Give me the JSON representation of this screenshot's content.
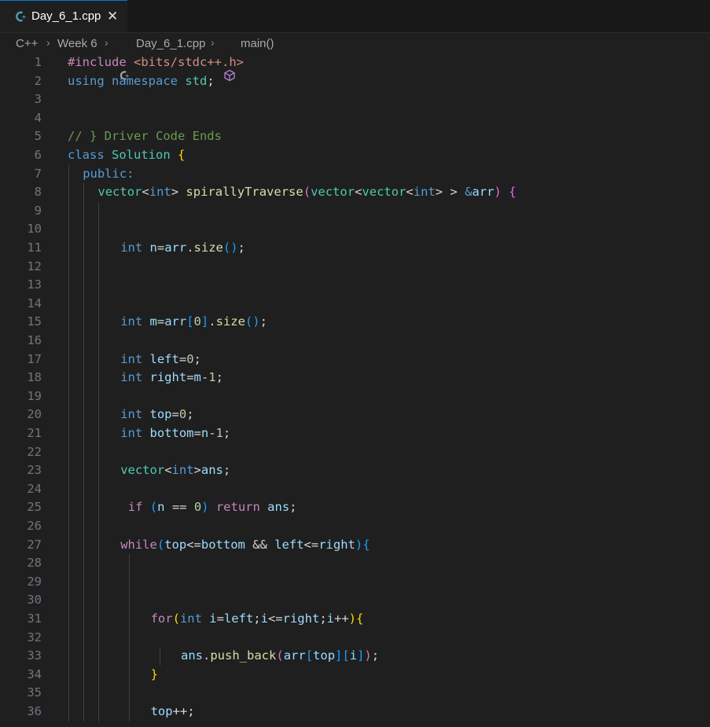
{
  "tab": {
    "icon": "cpp-file-icon",
    "label": "Day_6_1.cpp",
    "close": "✕"
  },
  "breadcrumb": [
    "C++",
    "Week 6",
    "Day_6_1.cpp",
    "main()"
  ],
  "editor": {
    "lines": [
      {
        "n": "1",
        "indent": 0,
        "tokens": [
          [
            "pre",
            "#include "
          ],
          [
            "str",
            "<bits/stdc++.h>"
          ]
        ]
      },
      {
        "n": "2",
        "indent": 0,
        "tokens": [
          [
            "kw",
            "using "
          ],
          [
            "kw",
            "namespace "
          ],
          [
            "type",
            "std"
          ],
          [
            "pl",
            ";"
          ]
        ]
      },
      {
        "n": "3",
        "indent": 0,
        "tokens": []
      },
      {
        "n": "4",
        "indent": 0,
        "tokens": []
      },
      {
        "n": "5",
        "indent": 0,
        "tokens": [
          [
            "cmt",
            "// } Driver Code Ends"
          ]
        ]
      },
      {
        "n": "6",
        "indent": 0,
        "tokens": [
          [
            "kw",
            "class "
          ],
          [
            "type",
            "Solution "
          ],
          [
            "p1",
            "{"
          ]
        ]
      },
      {
        "n": "7",
        "indent": 2,
        "tokens": [
          [
            "kw",
            "public:"
          ]
        ]
      },
      {
        "n": "8",
        "indent": 4,
        "tokens": [
          [
            "type",
            "vector"
          ],
          [
            "op",
            "<"
          ],
          [
            "kw",
            "int"
          ],
          [
            "op",
            "> "
          ],
          [
            "fn",
            "spirallyTraverse"
          ],
          [
            "p2",
            "("
          ],
          [
            "type",
            "vector"
          ],
          [
            "op",
            "<"
          ],
          [
            "type",
            "vector"
          ],
          [
            "op",
            "<"
          ],
          [
            "kw",
            "int"
          ],
          [
            "op",
            "> > "
          ],
          [
            "kw",
            "&"
          ],
          [
            "var",
            "arr"
          ],
          [
            "p2",
            ")"
          ],
          [
            "pl",
            " "
          ],
          [
            "p2",
            "{"
          ]
        ]
      },
      {
        "n": "9",
        "indent": 0,
        "tokens": []
      },
      {
        "n": "10",
        "indent": 0,
        "tokens": []
      },
      {
        "n": "11",
        "indent": 7,
        "tokens": [
          [
            "kw",
            "int "
          ],
          [
            "var",
            "n"
          ],
          [
            "op",
            "="
          ],
          [
            "var",
            "arr"
          ],
          [
            "pl",
            "."
          ],
          [
            "fn",
            "size"
          ],
          [
            "p3",
            "()"
          ],
          [
            "pl",
            ";"
          ]
        ]
      },
      {
        "n": "12",
        "indent": 0,
        "tokens": []
      },
      {
        "n": "13",
        "indent": 0,
        "tokens": []
      },
      {
        "n": "14",
        "indent": 0,
        "tokens": []
      },
      {
        "n": "15",
        "indent": 7,
        "tokens": [
          [
            "kw",
            "int "
          ],
          [
            "var",
            "m"
          ],
          [
            "op",
            "="
          ],
          [
            "var",
            "arr"
          ],
          [
            "p3",
            "["
          ],
          [
            "num",
            "0"
          ],
          [
            "p3",
            "]"
          ],
          [
            "pl",
            "."
          ],
          [
            "fn",
            "size"
          ],
          [
            "p3",
            "()"
          ],
          [
            "pl",
            ";"
          ]
        ]
      },
      {
        "n": "16",
        "indent": 0,
        "tokens": []
      },
      {
        "n": "17",
        "indent": 7,
        "tokens": [
          [
            "kw",
            "int "
          ],
          [
            "var",
            "left"
          ],
          [
            "op",
            "="
          ],
          [
            "num",
            "0"
          ],
          [
            "pl",
            ";"
          ]
        ]
      },
      {
        "n": "18",
        "indent": 7,
        "tokens": [
          [
            "kw",
            "int "
          ],
          [
            "var",
            "right"
          ],
          [
            "op",
            "="
          ],
          [
            "var",
            "m"
          ],
          [
            "op",
            "-"
          ],
          [
            "num",
            "1"
          ],
          [
            "pl",
            ";"
          ]
        ]
      },
      {
        "n": "19",
        "indent": 0,
        "tokens": []
      },
      {
        "n": "20",
        "indent": 7,
        "tokens": [
          [
            "kw",
            "int "
          ],
          [
            "var",
            "top"
          ],
          [
            "op",
            "="
          ],
          [
            "num",
            "0"
          ],
          [
            "pl",
            ";"
          ]
        ]
      },
      {
        "n": "21",
        "indent": 7,
        "tokens": [
          [
            "kw",
            "int "
          ],
          [
            "var",
            "bottom"
          ],
          [
            "op",
            "="
          ],
          [
            "var",
            "n"
          ],
          [
            "op",
            "-"
          ],
          [
            "num",
            "1"
          ],
          [
            "pl",
            ";"
          ]
        ]
      },
      {
        "n": "22",
        "indent": 0,
        "tokens": []
      },
      {
        "n": "23",
        "indent": 7,
        "tokens": [
          [
            "type",
            "vector"
          ],
          [
            "op",
            "<"
          ],
          [
            "kw",
            "int"
          ],
          [
            "op",
            ">"
          ],
          [
            "var",
            "ans"
          ],
          [
            "pl",
            ";"
          ]
        ]
      },
      {
        "n": "24",
        "indent": 0,
        "tokens": []
      },
      {
        "n": "25",
        "indent": 8,
        "tokens": [
          [
            "ctl",
            "if "
          ],
          [
            "p3",
            "("
          ],
          [
            "var",
            "n "
          ],
          [
            "op",
            "== "
          ],
          [
            "num",
            "0"
          ],
          [
            "p3",
            ")"
          ],
          [
            "pl",
            " "
          ],
          [
            "ctl",
            "return "
          ],
          [
            "var",
            "ans"
          ],
          [
            "pl",
            ";"
          ]
        ]
      },
      {
        "n": "26",
        "indent": 0,
        "tokens": []
      },
      {
        "n": "27",
        "indent": 7,
        "tokens": [
          [
            "ctl",
            "while"
          ],
          [
            "p3",
            "("
          ],
          [
            "var",
            "top"
          ],
          [
            "op",
            "<="
          ],
          [
            "var",
            "bottom "
          ],
          [
            "op",
            "&& "
          ],
          [
            "var",
            "left"
          ],
          [
            "op",
            "<="
          ],
          [
            "var",
            "right"
          ],
          [
            "p3",
            ")"
          ],
          [
            "p3",
            "{"
          ]
        ]
      },
      {
        "n": "28",
        "indent": 0,
        "tokens": []
      },
      {
        "n": "29",
        "indent": 0,
        "tokens": []
      },
      {
        "n": "30",
        "indent": 0,
        "tokens": []
      },
      {
        "n": "31",
        "indent": 11,
        "tokens": [
          [
            "ctl",
            "for"
          ],
          [
            "p1",
            "("
          ],
          [
            "kw",
            "int "
          ],
          [
            "var",
            "i"
          ],
          [
            "op",
            "="
          ],
          [
            "var",
            "left"
          ],
          [
            "pl",
            ";"
          ],
          [
            "var",
            "i"
          ],
          [
            "op",
            "<="
          ],
          [
            "var",
            "right"
          ],
          [
            "pl",
            ";"
          ],
          [
            "var",
            "i"
          ],
          [
            "op",
            "++"
          ],
          [
            "p1",
            ")"
          ],
          [
            "p1",
            "{"
          ]
        ]
      },
      {
        "n": "32",
        "indent": 0,
        "tokens": []
      },
      {
        "n": "33",
        "indent": 15,
        "tokens": [
          [
            "var",
            "ans"
          ],
          [
            "pl",
            "."
          ],
          [
            "fn",
            "push_back"
          ],
          [
            "p2",
            "("
          ],
          [
            "var",
            "arr"
          ],
          [
            "p3",
            "["
          ],
          [
            "var",
            "top"
          ],
          [
            "p3",
            "]"
          ],
          [
            "p3",
            "["
          ],
          [
            "var",
            "i"
          ],
          [
            "p3",
            "]"
          ],
          [
            "p2",
            ")"
          ],
          [
            "pl",
            ";"
          ]
        ]
      },
      {
        "n": "34",
        "indent": 11,
        "tokens": [
          [
            "p1",
            "}"
          ]
        ]
      },
      {
        "n": "35",
        "indent": 0,
        "tokens": []
      },
      {
        "n": "36",
        "indent": 11,
        "tokens": [
          [
            "var",
            "top"
          ],
          [
            "op",
            "++"
          ],
          [
            "pl",
            ";"
          ]
        ]
      }
    ]
  },
  "colors": {
    "background": "#1f1f1f",
    "accent": "#0078d4"
  }
}
